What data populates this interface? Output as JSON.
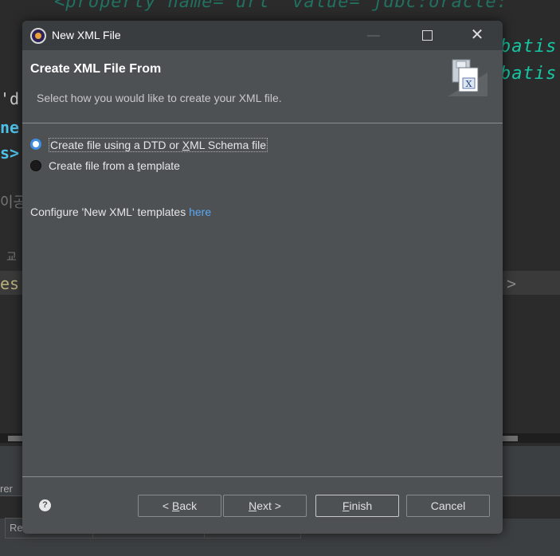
{
  "background": {
    "code_lines": [
      "<property name=\"url\" value=\"jdbc:oracle:",
      "batis",
      "batis"
    ],
    "fragments": [
      "'d",
      "ne",
      "s>",
      "es",
      ">",
      "rer",
      "Re"
    ],
    "korean_glyphs": [
      "이공",
      "교"
    ]
  },
  "dialog": {
    "title": "New XML File",
    "window_controls": {
      "minimize": "—",
      "close": "✕"
    },
    "header": {
      "title": "Create XML File From",
      "description": "Select how you would like to create your XML file."
    },
    "options": [
      {
        "label_pre": "Create file using a DTD or ",
        "label_mnemonic": "X",
        "label_post": "ML Schema file",
        "selected": true
      },
      {
        "label_pre": "Create file from a ",
        "label_mnemonic": "t",
        "label_post": "emplate",
        "selected": false
      }
    ],
    "config_text": "Configure 'New XML' templates ",
    "config_link": "here",
    "help_label": "?",
    "buttons": {
      "back_prefix": "< ",
      "back_mnemonic": "B",
      "back_rest": "ack",
      "next_mnemonic": "N",
      "next_rest": "ext >",
      "finish_mnemonic": "F",
      "finish_rest": "inish",
      "cancel": "Cancel"
    },
    "colors": {
      "accent": "#3d8ee0",
      "link": "#5ba8f5",
      "dialog_bg": "#4d5154"
    }
  }
}
